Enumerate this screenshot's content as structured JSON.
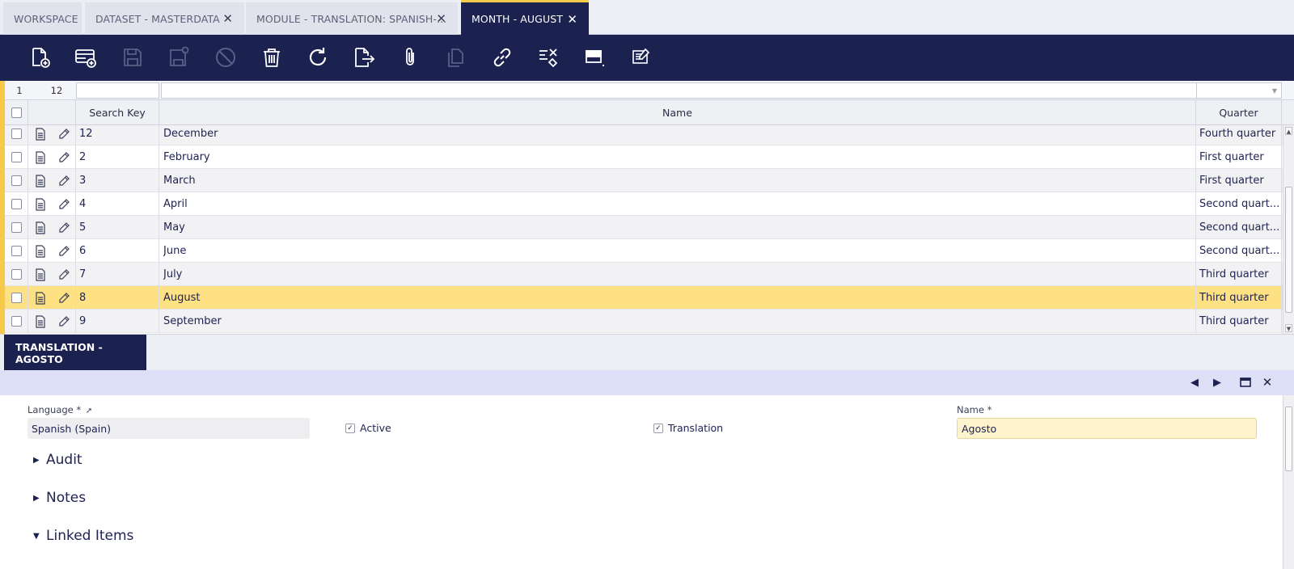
{
  "tabs": [
    {
      "label": "WORKSPACE",
      "closable": false,
      "active": false
    },
    {
      "label": "DATASET - MASTERDATA",
      "closable": true,
      "active": false
    },
    {
      "label": "MODULE - TRANSLATION: SPANISH-...",
      "closable": true,
      "active": false
    },
    {
      "label": "MONTH - AUGUST",
      "closable": true,
      "active": true
    }
  ],
  "close_glyph": "✕",
  "toolbar": {
    "buttons": [
      {
        "name": "new-document-icon",
        "enabled": true
      },
      {
        "name": "new-row-icon",
        "enabled": true
      },
      {
        "name": "save-icon",
        "enabled": false
      },
      {
        "name": "save-close-icon",
        "enabled": false
      },
      {
        "name": "undo-icon",
        "enabled": false
      },
      {
        "name": "delete-icon",
        "enabled": true
      },
      {
        "name": "refresh-icon",
        "enabled": true
      },
      {
        "name": "export-icon",
        "enabled": true
      },
      {
        "name": "attachment-icon",
        "enabled": true
      },
      {
        "name": "clone-icon",
        "enabled": false
      },
      {
        "name": "link-icon",
        "enabled": true
      },
      {
        "name": "tools-icon",
        "enabled": true
      },
      {
        "name": "toggle-view-icon",
        "enabled": true
      },
      {
        "name": "notes-icon",
        "enabled": true
      }
    ]
  },
  "grid": {
    "selected_count": "1",
    "total_count": "12",
    "columns": {
      "search_key": "Search Key",
      "name": "Name",
      "quarter": "Quarter"
    },
    "rows": [
      {
        "key": "12",
        "name": "December",
        "quarter": "Fourth quarter",
        "selected": false
      },
      {
        "key": "2",
        "name": "February",
        "quarter": "First quarter",
        "selected": false
      },
      {
        "key": "3",
        "name": "March",
        "quarter": "First quarter",
        "selected": false
      },
      {
        "key": "4",
        "name": "April",
        "quarter": "Second quart...",
        "selected": false
      },
      {
        "key": "5",
        "name": "May",
        "quarter": "Second quart...",
        "selected": false
      },
      {
        "key": "6",
        "name": "June",
        "quarter": "Second quart...",
        "selected": false
      },
      {
        "key": "7",
        "name": "July",
        "quarter": "Third quarter",
        "selected": false
      },
      {
        "key": "8",
        "name": "August",
        "quarter": "Third quarter",
        "selected": true
      },
      {
        "key": "9",
        "name": "September",
        "quarter": "Third quarter",
        "selected": false
      }
    ]
  },
  "subtab": {
    "label": "TRANSLATION - AGOSTO"
  },
  "form": {
    "language_label": "Language *",
    "language_value": "Spanish (Spain)",
    "active_label": "Active",
    "active_checked": true,
    "translation_label": "Translation",
    "translation_checked": true,
    "name_label": "Name *",
    "name_value": "Agosto",
    "sections": [
      {
        "label": "Audit",
        "expanded": false
      },
      {
        "label": "Notes",
        "expanded": false
      },
      {
        "label": "Linked Items",
        "expanded": true
      }
    ]
  },
  "colors": {
    "accent": "#f7c948",
    "navy": "#1c2250",
    "selected_row": "#fde182",
    "required_field": "#fdf3cc"
  }
}
